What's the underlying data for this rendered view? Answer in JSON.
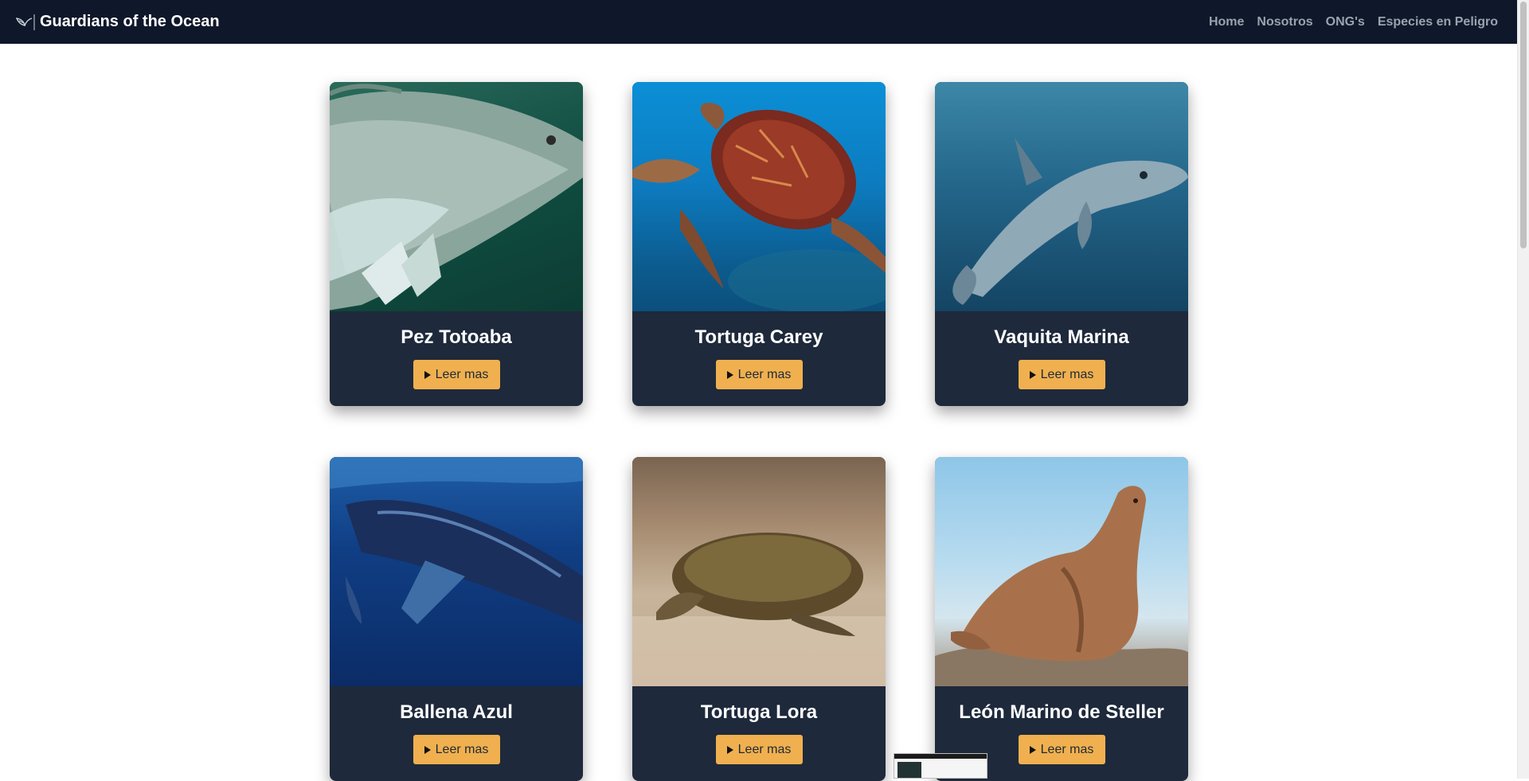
{
  "navbar": {
    "brand": "Guardians of the Ocean",
    "logo_icon": "wing-logo-icon",
    "links": [
      "Home",
      "Nosotros",
      "ONG's",
      "Especies en Peligro"
    ]
  },
  "cards": [
    {
      "title": "Pez Totoaba",
      "button": "Leer mas"
    },
    {
      "title": "Tortuga Carey",
      "button": "Leer mas"
    },
    {
      "title": "Vaquita Marina",
      "button": "Leer mas"
    },
    {
      "title": "Ballena Azul",
      "button": "Leer mas"
    },
    {
      "title": "Tortuga Lora",
      "button": "Leer mas"
    },
    {
      "title": "León Marino de Steller",
      "button": "Leer mas"
    }
  ],
  "colors": {
    "navbar": "#0f172a",
    "card_body": "#1e293b",
    "button": "#f0b04f",
    "nav_link": "#9aa3ad"
  }
}
